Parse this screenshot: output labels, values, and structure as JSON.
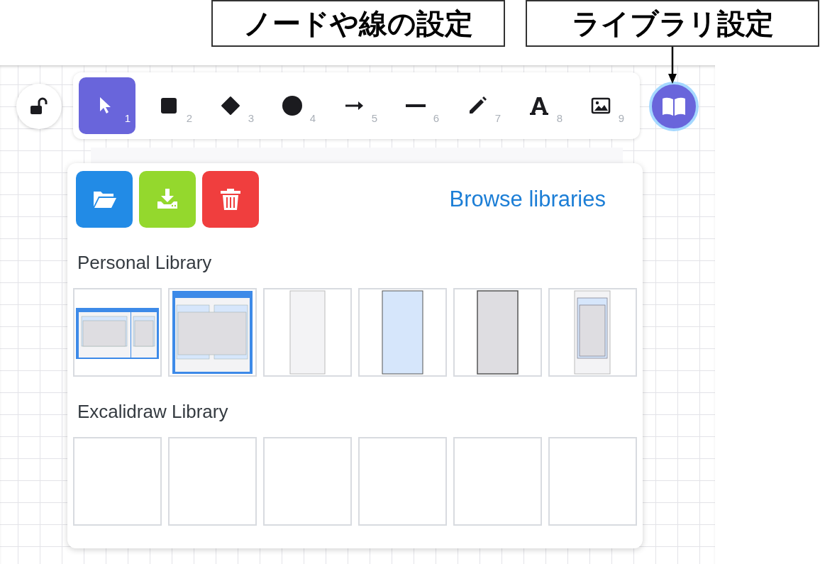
{
  "annotations": [
    {
      "label": "ノードや線の設定",
      "arrow": false
    },
    {
      "label": "ライブラリ設定",
      "arrow": true
    }
  ],
  "toolbar": {
    "locked": false,
    "tools": [
      {
        "kind": "select",
        "number": "1",
        "selected": true
      },
      {
        "kind": "rectangle",
        "number": "2",
        "selected": false
      },
      {
        "kind": "diamond",
        "number": "3",
        "selected": false
      },
      {
        "kind": "ellipse",
        "number": "4",
        "selected": false
      },
      {
        "kind": "arrow",
        "number": "5",
        "selected": false
      },
      {
        "kind": "line",
        "number": "6",
        "selected": false
      },
      {
        "kind": "pencil",
        "number": "7",
        "selected": false
      },
      {
        "kind": "text",
        "number": "8",
        "selected": false
      },
      {
        "kind": "image",
        "number": "9",
        "selected": false
      }
    ]
  },
  "library_button": {
    "selected": true
  },
  "hint_bar": true,
  "library": {
    "actions": [
      {
        "kind": "open",
        "color": "#228be6"
      },
      {
        "kind": "download",
        "color": "#94d82d"
      },
      {
        "kind": "delete",
        "color": "#f03e3e"
      }
    ],
    "browse_link": "Browse libraries",
    "sections": [
      {
        "title": "Personal Library",
        "items": [
          {
            "kind": "two-regions"
          },
          {
            "kind": "diagram"
          },
          {
            "kind": "region"
          },
          {
            "kind": "zone"
          },
          {
            "kind": "subnet"
          },
          {
            "kind": "nested"
          }
        ]
      },
      {
        "title": "Excalidraw Library",
        "items": [
          {
            "kind": "empty"
          },
          {
            "kind": "empty"
          },
          {
            "kind": "empty"
          },
          {
            "kind": "empty"
          },
          {
            "kind": "empty"
          },
          {
            "kind": "empty"
          }
        ]
      }
    ]
  }
}
